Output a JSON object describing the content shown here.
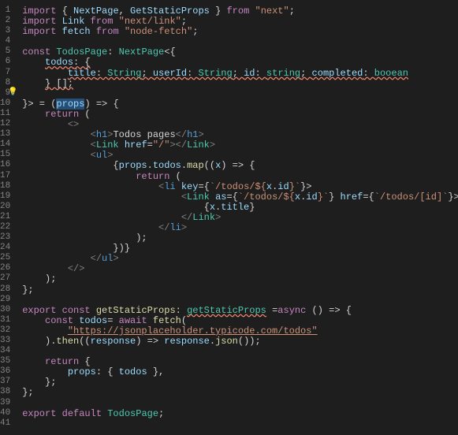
{
  "lines": {
    "l1_import": "import",
    "l1_braces": " { ",
    "l1_nextpage": "NextPage",
    "l1_comma": ", ",
    "l1_gsp": "GetStaticProps",
    "l1_close": " } ",
    "l1_from": "from ",
    "l1_str": "\"next\"",
    "l1_semi": ";",
    "l2_import": "import",
    "l2_link": " Link ",
    "l2_from": "from ",
    "l2_str": "\"next/link\"",
    "l2_semi": ";",
    "l3_import": "import",
    "l3_fetch": " fetch ",
    "l3_from": "from ",
    "l3_str": "\"node-fetch\"",
    "l3_semi": ";",
    "l5_const": "const ",
    "l5_name": "TodosPage",
    "l5_colon": ": ",
    "l5_type": "NextPage",
    "l5_angle": "<{",
    "l6_indent": "    ",
    "l6_todos": "todos",
    "l6_colon": ": {",
    "l7_indent": "        ",
    "l7_title": "title",
    "l7_c1": ": ",
    "l7_str1": "String",
    "l7_sc1": "; ",
    "l7_uid": "userId",
    "l7_c2": ": ",
    "l7_str2": "String",
    "l7_sc2": "; ",
    "l7_id": "id",
    "l7_c3": ": ",
    "l7_str3": "string",
    "l7_sc3": "; ",
    "l7_comp": "completed",
    "l7_c4": ": ",
    "l7_bool": "booean",
    "l8_indent": "    ",
    "l8_close": "} [];",
    "l10_close": "}> = (",
    "l10_props": "props",
    "l10_arrow": ") => {",
    "l11_indent": "    ",
    "l11_return": "return",
    "l11_paren": " (",
    "l12_indent": "        ",
    "l12_frag": "<>",
    "l13_indent": "            ",
    "l13_open": "<",
    "l13_tag": "h1",
    "l13_close": ">",
    "l13_text": "Todos pages",
    "l13_close2": "</",
    "l13_tag2": "h1",
    "l13_close3": ">",
    "l14_indent": "            ",
    "l14_open": "<",
    "l14_link": "Link",
    "l14_sp": " ",
    "l14_href": "href",
    "l14_eq": "=",
    "l14_val": "\"/\"",
    "l14_close": "></",
    "l14_link2": "Link",
    "l14_close2": ">",
    "l15_indent": "            ",
    "l15_open": "<",
    "l15_ul": "ul",
    "l15_close": ">",
    "l16_indent": "                ",
    "l16_brace": "{",
    "l16_props": "props",
    "l16_dot": ".",
    "l16_todos": "todos",
    "l16_dot2": ".",
    "l16_map": "map",
    "l16_paren": "((",
    "l16_x": "x",
    "l16_arrow": ") => {",
    "l17_indent": "                    ",
    "l17_return": "return",
    "l17_paren": " (",
    "l18_indent": "                        ",
    "l18_open": "<",
    "l18_li": "li",
    "l18_sp": " ",
    "l18_key": "key",
    "l18_eq": "={",
    "l18_tmpl": "`/todos/${",
    "l18_x": "x",
    "l18_dot": ".",
    "l18_id": "id",
    "l18_tmplc": "}`",
    "l18_close": "}>",
    "l19_indent": "                            ",
    "l19_open": "<",
    "l19_link": "Link",
    "l19_sp": " ",
    "l19_as": "as",
    "l19_eq": "={",
    "l19_tmpl": "`/todos/${",
    "l19_x": "x",
    "l19_dot": ".",
    "l19_id": "id",
    "l19_tmplc": "}`",
    "l19_close": "} ",
    "l19_href": "href",
    "l19_eq2": "={",
    "l19_tmpl2": "`/todos/[id]`",
    "l19_close2": "}>",
    "l20_indent": "                                ",
    "l20_brace": "{",
    "l20_x": "x",
    "l20_dot": ".",
    "l20_title": "title",
    "l20_close": "}",
    "l21_indent": "                            ",
    "l21_close": "</",
    "l21_link": "Link",
    "l21_close2": ">",
    "l22_indent": "                        ",
    "l22_close": "</",
    "l22_li": "li",
    "l22_close2": ">",
    "l23_indent": "                    ",
    "l23_paren": ");",
    "l24_indent": "                ",
    "l24_close": "})}",
    "l25_indent": "            ",
    "l25_close": "</",
    "l25_ul": "ul",
    "l25_close2": ">",
    "l26_indent": "        ",
    "l26_frag": "</>",
    "l27_indent": "    ",
    "l27_paren": ");",
    "l28_close": "};",
    "l30_export": "export const",
    "l30_sp": " ",
    "l30_name": "getStaticProps",
    "l30_colon": ": ",
    "l30_type": "getStaticProps",
    "l30_sp2": " =",
    "l30_async": "async",
    "l30_arrow": " () => {",
    "l31_indent": "    ",
    "l31_const": "const",
    "l31_sp": " ",
    "l31_todos": "todos",
    "l31_eq": "= ",
    "l31_await": "await",
    "l31_sp2": " ",
    "l31_fetch": "fetch",
    "l31_paren": "(",
    "l32_indent": "        ",
    "l32_url": "\"https://jsonplaceholder.typicode.com/todos\"",
    "l33_indent": "    ",
    "l33_close": ").",
    "l33_then": "then",
    "l33_paren": "((",
    "l33_resp": "response",
    "l33_arrow": ") => ",
    "l33_resp2": "response",
    "l33_dot": ".",
    "l33_json": "json",
    "l33_close2": "());",
    "l35_indent": "    ",
    "l35_return": "return",
    "l35_brace": " {",
    "l36_indent": "        ",
    "l36_props": "props",
    "l36_colon": ": { ",
    "l36_todos": "todos",
    "l36_close": " },",
    "l37_indent": "    ",
    "l37_close": "};",
    "l38_close": "};",
    "l40_export": "export default",
    "l40_sp": " ",
    "l40_name": "TodosPage",
    "l40_semi": ";"
  },
  "line_numbers": [
    "1",
    "2",
    "3",
    "4",
    "5",
    "6",
    "7",
    "8",
    "9",
    "10",
    "11",
    "12",
    "13",
    "14",
    "15",
    "16",
    "17",
    "18",
    "19",
    "20",
    "21",
    "22",
    "23",
    "24",
    "25",
    "26",
    "27",
    "28",
    "29",
    "30",
    "31",
    "32",
    "33",
    "34",
    "35",
    "36",
    "37",
    "38",
    "39",
    "40",
    "41"
  ]
}
